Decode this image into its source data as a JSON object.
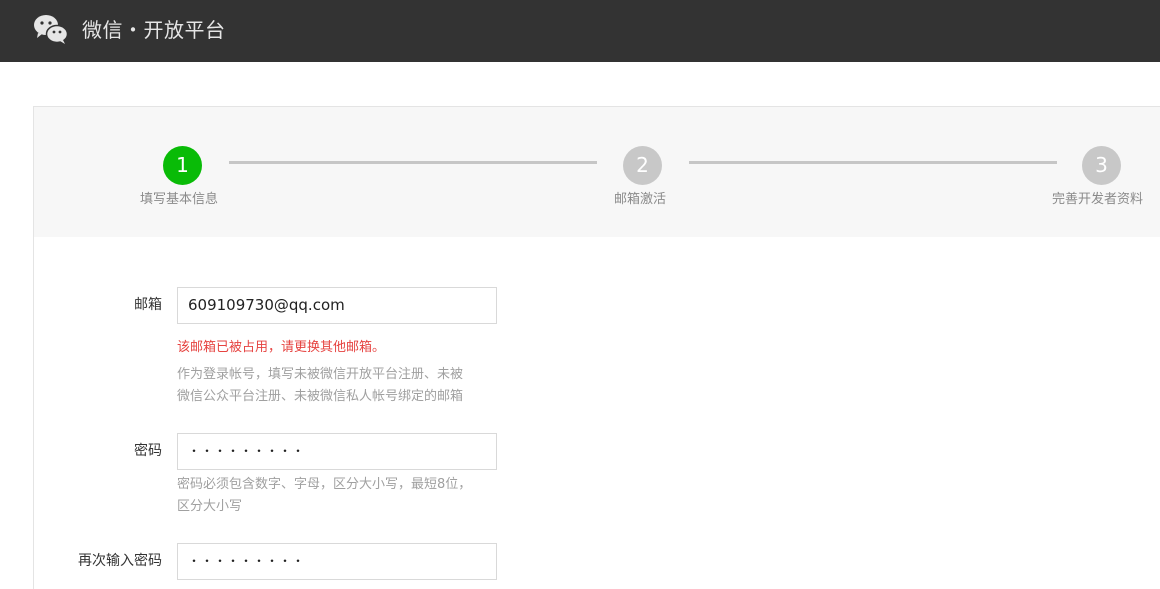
{
  "header": {
    "brand": "微信・开放平台",
    "logo_icon": "wechat-logo-icon"
  },
  "steps": [
    {
      "number": "1",
      "label": "填写基本信息",
      "state": "active"
    },
    {
      "number": "2",
      "label": "邮箱激活",
      "state": "pending"
    },
    {
      "number": "3",
      "label": "完善开发者资料",
      "state": "pending"
    }
  ],
  "form": {
    "email": {
      "label": "邮箱",
      "value": "609109730@qq.com",
      "error": "该邮箱已被占用，请更换其他邮箱。",
      "tip_line1": "作为登录帐号，填写未被微信开放平台注册、未被",
      "tip_line2": "微信公众平台注册、未被微信私人帐号绑定的邮箱"
    },
    "password": {
      "label": "密码",
      "masked_value": "・・・・・・・・・",
      "tip_line1": "密码必须包含数字、字母，区分大小写，最短8位，",
      "tip_line2": "区分大小写"
    },
    "confirm_password": {
      "label": "再次输入密码",
      "masked_value": "・・・・・・・・・"
    }
  },
  "colors": {
    "header_bg": "#333333",
    "active_step": "#09bb07",
    "pending_step": "#c8c8c8",
    "error": "#e64340"
  }
}
